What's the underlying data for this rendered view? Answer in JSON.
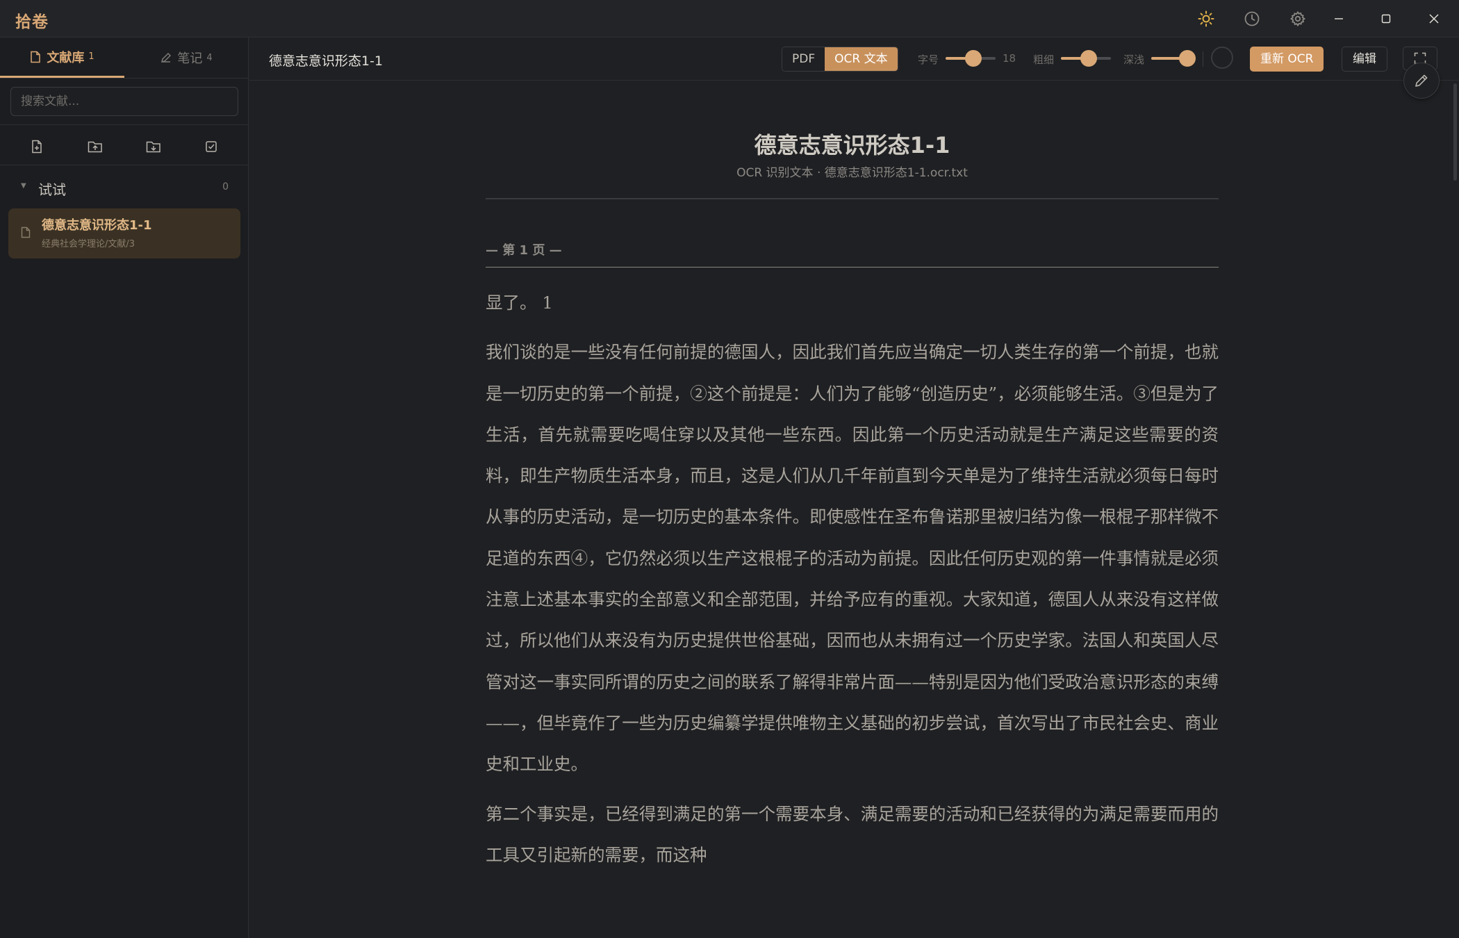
{
  "app": {
    "title": "拾卷"
  },
  "titlebar": {
    "theme_icon": "sun-icon",
    "history_icon": "clock-icon",
    "settings_icon": "gear-icon",
    "accent_color": "#d9a876"
  },
  "sidebar": {
    "tabs": [
      {
        "label": "文献库",
        "count": "1",
        "icon": "document-icon",
        "active": true
      },
      {
        "label": "笔记",
        "count": "4",
        "icon": "pen-icon",
        "active": false
      }
    ],
    "search": {
      "placeholder": "搜索文献..."
    },
    "tools": [
      "import-file-icon",
      "upload-folder-icon",
      "download-folder-icon",
      "checkbox-icon"
    ],
    "folder": {
      "name": "试试",
      "count": "0"
    },
    "items": [
      {
        "title": "德意志意识形态1-1",
        "path": "经典社会学理论/文献/3",
        "selected": true
      }
    ]
  },
  "toolbar": {
    "doc_name": "德意志意识形态1-1",
    "view_modes": [
      {
        "label": "PDF",
        "active": false
      },
      {
        "label": "OCR 文本",
        "active": true
      }
    ],
    "font_size": {
      "label": "字号",
      "value": "18",
      "level": 0.55
    },
    "weight": {
      "label": "粗细",
      "level": 0.55
    },
    "shade": {
      "label": "深浅",
      "level": 0.9
    },
    "reocr_label": "重新 OCR",
    "edit_label": "编辑"
  },
  "document": {
    "title": "德意志意识形态1-1",
    "meta": "OCR 识别文本 · 德意志意识形态1-1.ocr.txt",
    "page_marker": "— 第 1 页 —",
    "paragraphs": [
      "显了。 1",
      "我们谈的是一些没有任何前提的德国人，因此我们首先应当确定一切人类生存的第一个前提，也就是一切历史的第一个前提，②这个前提是：人们为了能够“创造历史”，必须能够生活。③但是为了生活，首先就需要吃喝住穿以及其他一些东西。因此第一个历史活动就是生产满足这些需要的资料，即生产物质生活本身，而且，这是人们从几千年前直到今天单是为了维持生活就必须每日每时从事的历史活动，是一切历史的基本条件。即使感性在圣布鲁诺那里被归结为像一根棍子那样微不足道的东西④，它仍然必须以生产这根棍子的活动为前提。因此任何历史观的第一件事情就是必须注意上述基本事实的全部意义和全部范围，并给予应有的重视。大家知道，德国人从来没有这样做过，所以他们从来没有为历史提供世俗基础，因而也从未拥有过一个历史学家。法国人和英国人尽管对这一事实同所谓的历史之间的联系了解得非常片面——特别是因为他们受政治意识形态的束缚——，但毕竟作了一些为历史编纂学提供唯物主义基础的初步尝试，首次写出了市民社会史、商业史和工业史。",
      "第二个事实是，已经得到满足的第一个需要本身、满足需要的活动和已经获得的为满足需要而用的工具又引起新的需要，而这种"
    ]
  }
}
